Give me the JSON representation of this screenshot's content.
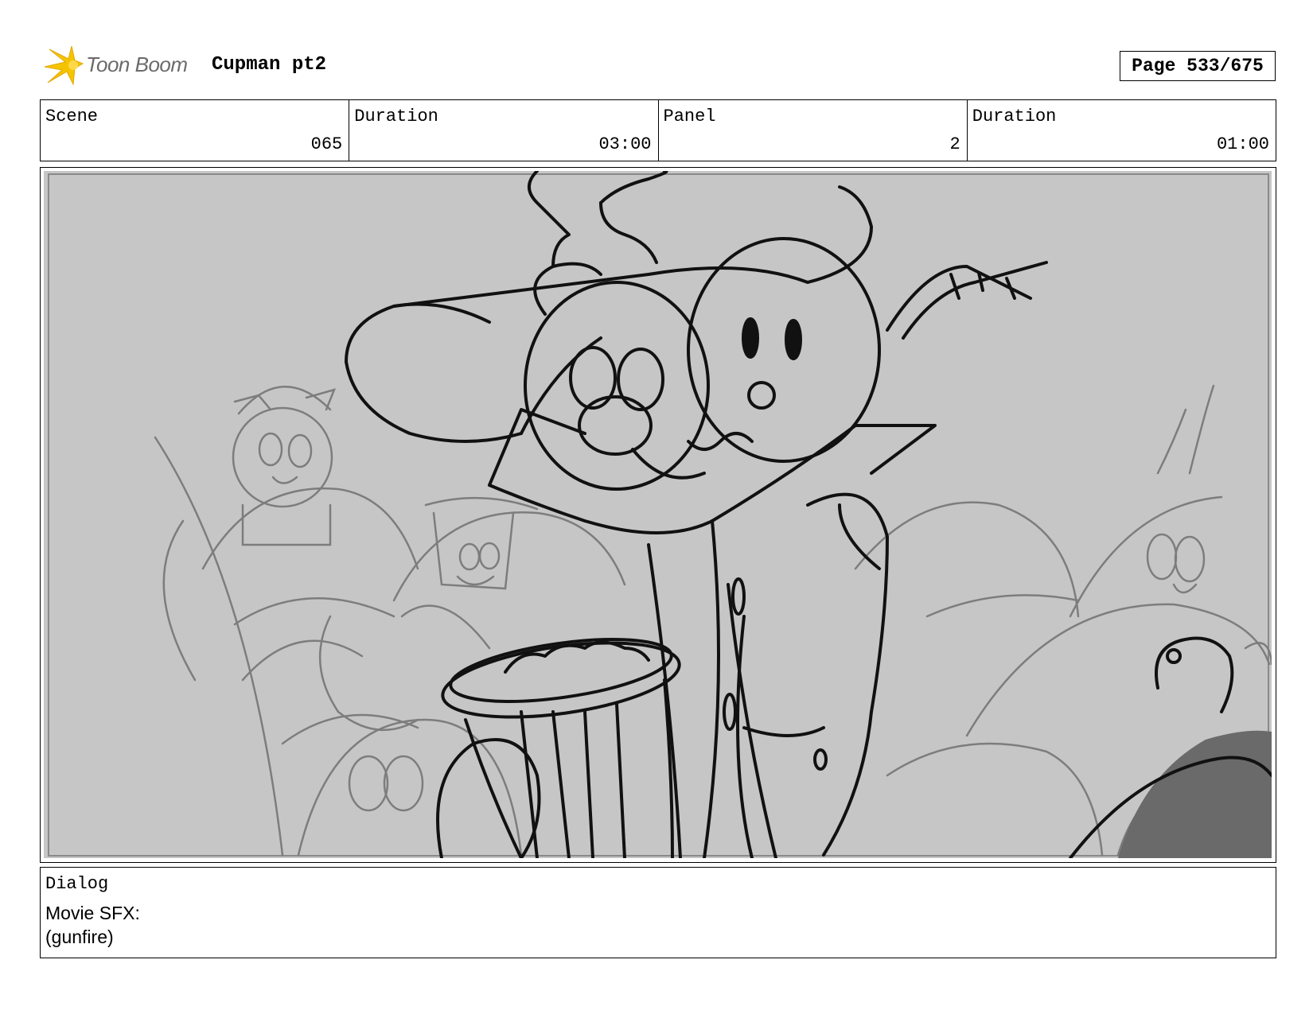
{
  "header": {
    "logo_text": "Toon Boom",
    "project_title": "Cupman pt2",
    "page_label": "Page 533/675"
  },
  "info": {
    "scene_label": "Scene",
    "scene_value": "065",
    "scene_duration_label": "Duration",
    "scene_duration_value": "03:00",
    "panel_label": "Panel",
    "panel_value": "2",
    "panel_duration_label": "Duration",
    "panel_duration_value": "01:00"
  },
  "panel": {
    "background_color": "#c6c6c6",
    "ink_color": "#111111",
    "sketch_color": "#7d7d7d"
  },
  "dialog": {
    "label": "Dialog",
    "lines": [
      "Movie SFX:",
      "(gunfire)"
    ]
  },
  "colors": {
    "logo_yellow": "#f5c400",
    "logo_text": "#6a6a6a"
  }
}
